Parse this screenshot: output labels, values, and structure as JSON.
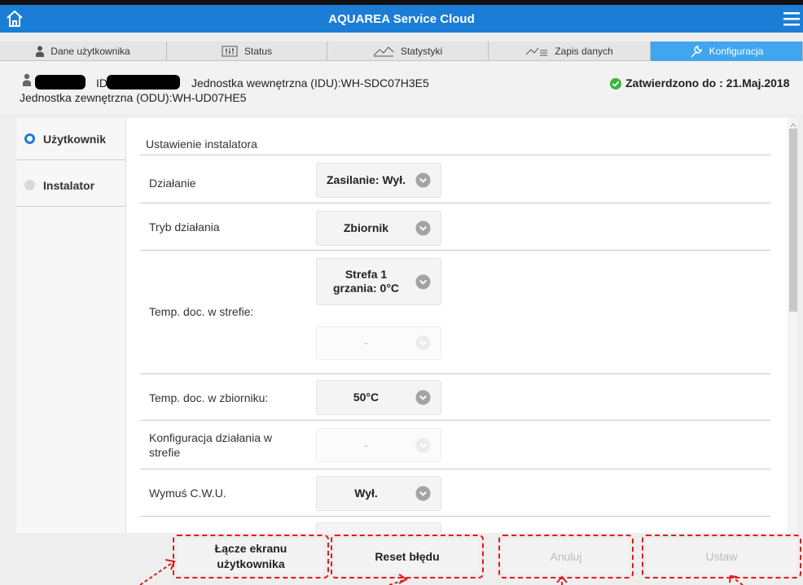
{
  "app": {
    "title": "AQUAREA Service Cloud"
  },
  "tabs": [
    {
      "label": "Dane użytkownika",
      "icon": "person-icon",
      "active": false
    },
    {
      "label": "Status",
      "icon": "status-icon",
      "active": false
    },
    {
      "label": "Statystyki",
      "icon": "chart-icon",
      "active": false
    },
    {
      "label": "Zapis danych",
      "icon": "data-log-icon",
      "active": false
    },
    {
      "label": "Konfiguracja",
      "icon": "wrench-icon",
      "active": true
    }
  ],
  "user": {
    "id_label": "ID",
    "idu": "Jednostka wewnętrzna (IDU):WH-SDC07H3E5",
    "odu": "Jednostka zewnętrzna (ODU):WH-UD07HE5",
    "approved": "Zatwierdzono do : 21.Maj.2018"
  },
  "nav": [
    {
      "label": "Użytkownik",
      "selected": true
    },
    {
      "label": "Instalator",
      "selected": false
    }
  ],
  "panel": {
    "section_title": "Ustawienie instalatora",
    "rows": [
      {
        "label": "Działanie",
        "value": "Zasilanie: Wył."
      },
      {
        "label": "Tryb działania",
        "value": "Zbiornik"
      },
      {
        "label": "Temp. doc. w strefie:",
        "value": "Strefa 1\ngrzania: 0°C",
        "value2": "-"
      },
      {
        "label": "Temp. doc. w zbiorniku:",
        "value": "50°C"
      },
      {
        "label": "Konfiguracja działania w\nstrefie",
        "value": "-"
      },
      {
        "label": "Wymuś C.W.U.",
        "value": "Wył."
      }
    ]
  },
  "buttons": {
    "link": "Łącze ekranu\nużytkownika",
    "reset": "Reset błędu",
    "cancel": "Anuluj",
    "set": "Ustaw"
  },
  "colors": {
    "header": "#1b7dd6",
    "active_tab": "#3fa6ef",
    "highlight": "#e01b1b",
    "approved": "#3cb53c"
  }
}
